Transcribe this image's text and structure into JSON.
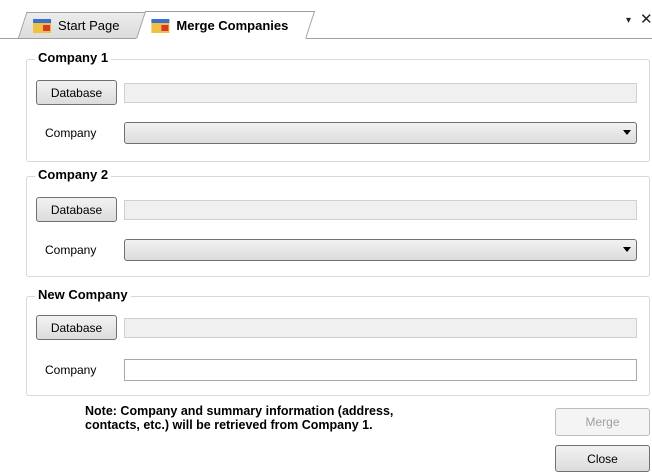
{
  "tabs": [
    {
      "label": "Start Page",
      "active": false,
      "icon": "form-icon"
    },
    {
      "label": "Merge Companies",
      "active": true,
      "icon": "form-icon"
    }
  ],
  "tabstrip": {
    "dropdown_glyph": "▾",
    "close_glyph": "✕"
  },
  "groups": [
    {
      "title": "Company 1",
      "database_label": "Database",
      "database_value": "",
      "company_label": "Company",
      "company_value": "",
      "company_control": "dropdown"
    },
    {
      "title": "Company 2",
      "database_label": "Database",
      "database_value": "",
      "company_label": "Company",
      "company_value": "",
      "company_control": "dropdown"
    },
    {
      "title": "New Company",
      "database_label": "Database",
      "database_value": "",
      "company_label": "Company",
      "company_value": "",
      "company_control": "textbox"
    }
  ],
  "note": {
    "line1": "Note: Company and summary information (address,",
    "line2": "contacts, etc.) will be retrieved from Company 1."
  },
  "buttons": {
    "merge_label": "Merge",
    "merge_enabled": false,
    "close_label": "Close"
  }
}
